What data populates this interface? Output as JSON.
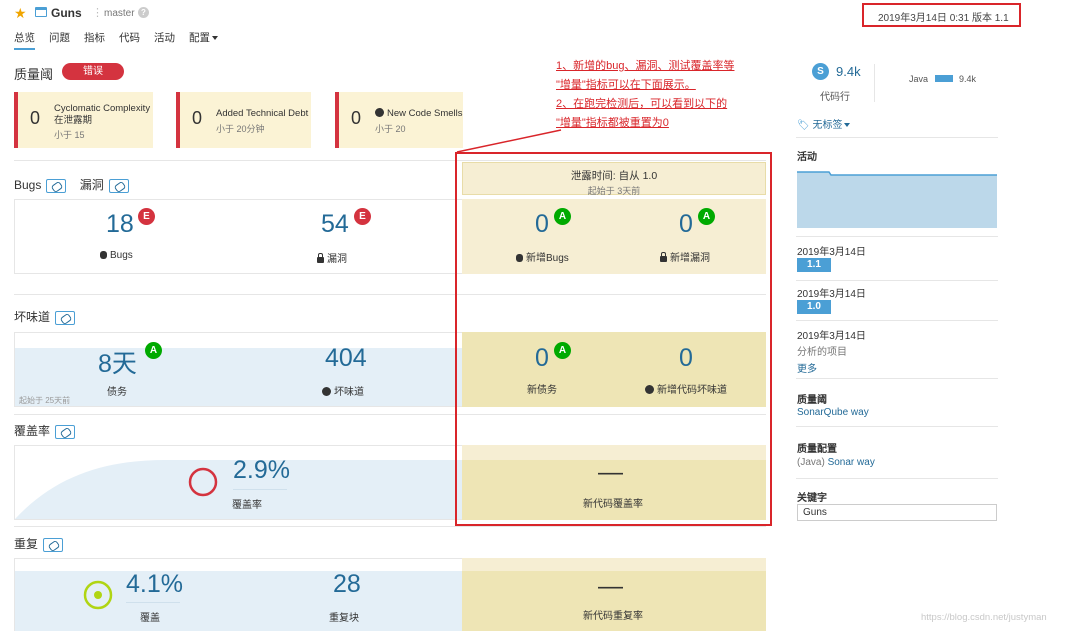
{
  "header": {
    "project_name": "Guns",
    "branch": "master",
    "date_version": "2019年3月14日 0:31   版本 1.1",
    "nav": [
      "总览",
      "问题",
      "指标",
      "代码",
      "活动",
      "配置"
    ]
  },
  "quality_gate": {
    "title": "质量阈",
    "status": "错误",
    "conditions": [
      {
        "value": "0",
        "label_line1": "Cyclomatic Complexity",
        "label_line2": "在泄露期",
        "threshold": "小于 15"
      },
      {
        "value": "0",
        "label_line1": "Added Technical Debt",
        "label_line2": "",
        "threshold": "小于 20分钟"
      },
      {
        "value": "0",
        "label_line1": "New Code Smells",
        "label_line2": "",
        "threshold": "小于 20"
      }
    ]
  },
  "annotation": {
    "lines": [
      "1、新增的bug、漏洞、测试覆盖率等",
      "\"增量\"指标可以在下面展示。",
      "2、在跑完检测后，可以看到以下的",
      "\"增量\"指标都被重置为0"
    ]
  },
  "leak": {
    "title": "泄露时间: 自从 1.0",
    "subtitle": "起始于 3天前"
  },
  "bugs_section": {
    "title_bugs": "Bugs",
    "title_vuln": "漏洞",
    "bugs_value": "18",
    "bugs_rating": "E",
    "bugs_label": "Bugs",
    "vuln_value": "54",
    "vuln_rating": "E",
    "vuln_label": "漏洞",
    "new_bugs_value": "0",
    "new_bugs_rating": "A",
    "new_bugs_label": "新增Bugs",
    "new_vuln_value": "0",
    "new_vuln_rating": "A",
    "new_vuln_label": "新增漏洞"
  },
  "smell_section": {
    "title": "坏味道",
    "debt_value": "8天",
    "debt_rating": "A",
    "debt_label": "债务",
    "debt_since": "起始于 25天前",
    "smells_value": "404",
    "smells_label": "坏味道",
    "new_debt_value": "0",
    "new_debt_rating": "A",
    "new_debt_label": "新债务",
    "new_smells_value": "0",
    "new_smells_label": "新增代码坏味道"
  },
  "coverage_section": {
    "title": "覆盖率",
    "coverage_value": "2.9%",
    "coverage_label": "覆盖率",
    "new_coverage_value": "—",
    "new_coverage_label": "新代码覆盖率"
  },
  "dup_section": {
    "title": "重复",
    "dup_value": "4.1%",
    "dup_label": "覆盖",
    "blocks_value": "28",
    "blocks_label": "重复块",
    "new_dup_value": "—",
    "new_dup_label": "新代码重复率"
  },
  "sidebar": {
    "loc_icon": "S",
    "loc_value": "9.4k",
    "loc_label": "代码行",
    "lang_name": "Java",
    "lang_value": "9.4k",
    "tags": "无标签",
    "activity_title": "活动",
    "events": [
      {
        "date": "2019年3月14日",
        "version": "1.1"
      },
      {
        "date": "2019年3月14日",
        "version": "1.0"
      }
    ],
    "last_date": "2019年3月14日",
    "last_text": "分析的项目",
    "more": "更多",
    "qg_title": "质量阈",
    "qg_value": "SonarQube way",
    "qp_title": "质量配置",
    "qp_lang": "(Java)",
    "qp_value": "Sonar way",
    "key_title": "关键字",
    "key_value": "Guns"
  },
  "watermark": "https://blog.csdn.net/justyman"
}
